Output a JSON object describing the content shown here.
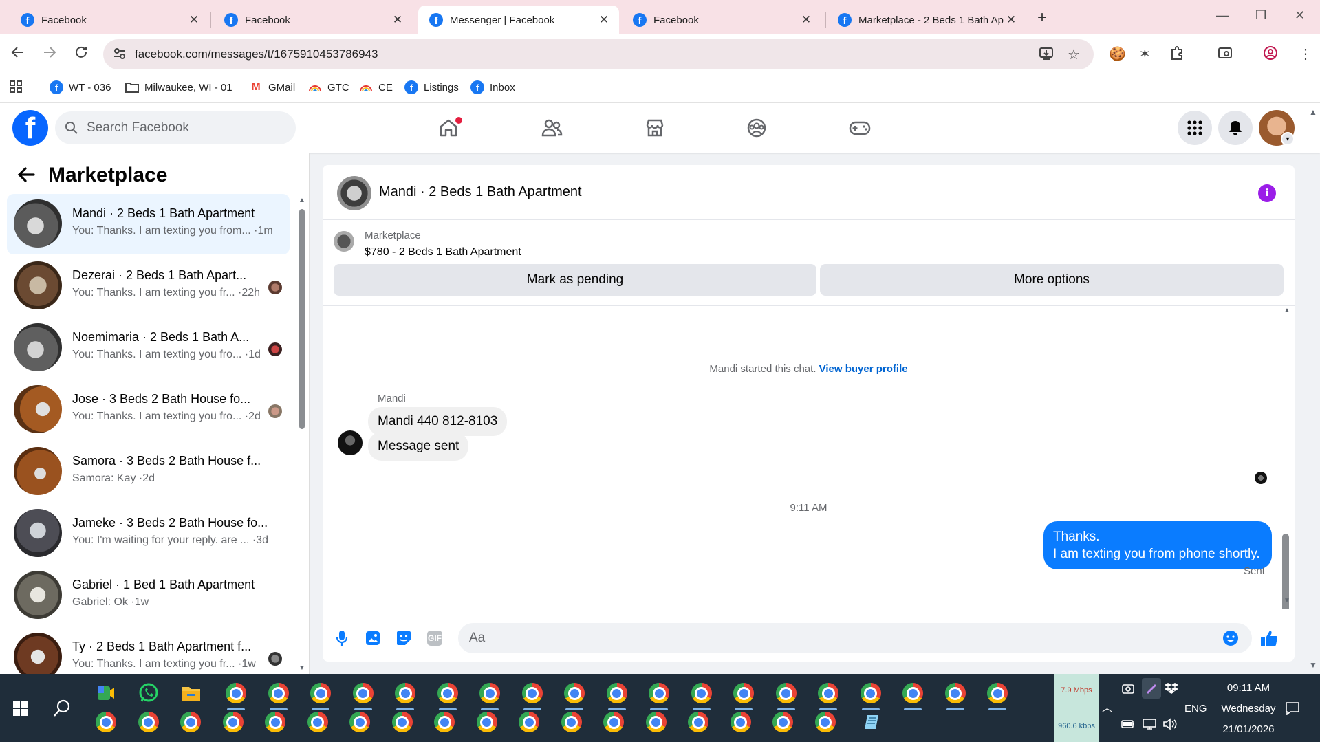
{
  "browser": {
    "tabs": [
      {
        "title": "Facebook",
        "active": false
      },
      {
        "title": "Facebook",
        "active": false
      },
      {
        "title": "Messenger | Facebook",
        "active": true
      },
      {
        "title": "Facebook",
        "active": false
      },
      {
        "title": "Marketplace - 2 Beds 1 Bath Ap",
        "active": false
      }
    ],
    "url": "facebook.com/messages/t/1675910453786943",
    "bookmarks": [
      "WT - 036",
      "Milwaukee, WI - 01",
      "GMail",
      "GTC",
      "CE",
      "Listings",
      "Inbox"
    ],
    "icons": {
      "back": "back-arrow-icon",
      "forward": "forward-arrow-icon",
      "reload": "reload-icon",
      "install": "install-icon",
      "star": "bookmark-star-icon"
    }
  },
  "fb": {
    "search_placeholder": "Search Facebook",
    "nav": [
      "home-icon",
      "friends-icon",
      "marketplace-icon",
      "groups-icon",
      "gaming-icon"
    ],
    "accent": "#0866ff"
  },
  "sidebar": {
    "title": "Marketplace",
    "conversations": [
      {
        "name": "Mandi · 2 Beds 1 Bath Apartment",
        "preview": "You: Thanks. I am texting you from... ·1m",
        "selected": true,
        "thumb": "#5b5b5b"
      },
      {
        "name": "Dezerai · 2 Beds 1 Bath Apart...",
        "preview": "You: Thanks. I am texting you fr... ·22h",
        "selected": false,
        "thumb": "#6b4a32"
      },
      {
        "name": "Noemimaria · 2 Beds 1 Bath A...",
        "preview": "You: Thanks. I am texting you fro... ·1d",
        "selected": false,
        "thumb": "#5f5f5f"
      },
      {
        "name": "Jose · 3 Beds 2 Bath House fo...",
        "preview": "You: Thanks. I am texting you fro... ·2d",
        "selected": false,
        "thumb": "#8a4b1d"
      },
      {
        "name": "Samora · 3 Beds 2 Bath House f...",
        "preview": "Samora: Kay ·2d",
        "selected": false,
        "thumb": "#9a521f"
      },
      {
        "name": "Jameke · 3 Beds 2 Bath House fo...",
        "preview": "You: I'm waiting for your reply. are ... ·3d",
        "selected": false,
        "thumb": "#4d4d55"
      },
      {
        "name": "Gabriel · 1 Bed 1 Bath Apartment",
        "preview": "Gabriel: Ok ·1w",
        "selected": false,
        "thumb": "#6d6a60"
      },
      {
        "name": "Ty · 2 Beds 1 Bath Apartment f...",
        "preview": "You: Thanks. I am texting you fr... ·1w",
        "selected": false,
        "thumb": "#6e3a22"
      }
    ]
  },
  "chat": {
    "title": "Mandi · 2 Beds 1 Bath Apartment",
    "listing_source": "Marketplace",
    "listing_title": "$780 - 2 Beds 1 Bath Apartment",
    "btn_pending": "Mark as pending",
    "btn_more": "More options",
    "started_text": "Mandi started this chat.",
    "buyer_profile_link": "View buyer profile",
    "sender_name": "Mandi",
    "incoming": [
      "Mandi 440 812-8103",
      "Message sent"
    ],
    "timestamp": "9:11 AM",
    "outgoing_line1": "Thanks.",
    "outgoing_line2": "I am texting you from phone shortly.",
    "status": "Sent",
    "input_placeholder": "Aa",
    "gif_label": "GIF",
    "bubble_color": "#0a7cff"
  },
  "taskbar": {
    "net_up": "7.9 Mbps",
    "net_down": "960.6 kbps",
    "lang": "ENG",
    "time": "09:11 AM",
    "day": "Wednesday",
    "date": "21/01/2026"
  }
}
